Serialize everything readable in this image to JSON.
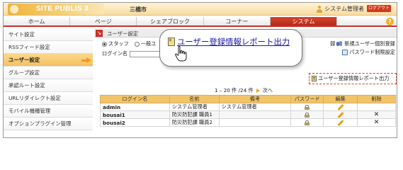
{
  "header": {
    "logo_text": "SITE PUBLIS 3",
    "site_name": "三橋市",
    "user_label": "システム管理者",
    "logout_label": "ログアウト"
  },
  "nav": {
    "tabs": [
      "ホーム",
      "ページ",
      "シェアブロック",
      "コーナー",
      "システム"
    ],
    "active": "システム",
    "help_icon": "?"
  },
  "sidebar": {
    "items": [
      {
        "label": "サイト設定",
        "active": false
      },
      {
        "label": "RSSフィード設定",
        "active": false
      },
      {
        "label": "ユーザー設定",
        "active": true
      },
      {
        "label": "グループ設定",
        "active": false
      },
      {
        "label": "承認ルート設定",
        "active": false
      },
      {
        "label": "URLリダイレクト設定",
        "active": false
      },
      {
        "label": "モバイル機種管理",
        "active": false
      },
      {
        "label": "オプションプラグイン管理",
        "active": false
      }
    ]
  },
  "content": {
    "section_title": "ユーザー設定",
    "radios": [
      {
        "label": "スタッフ",
        "checked": true
      },
      {
        "label": "一般ユ",
        "checked": false
      }
    ],
    "login_label": "ログイン名",
    "right_links": {
      "top_partial": "録",
      "new_individual": "新規ユーザー個別登録",
      "password_settings": "パスワード制限設定"
    },
    "report_link": "ユーザー登録情報レポート出力",
    "pager": {
      "text": "1 – 20 件 /24 件",
      "next": "次へ"
    },
    "table": {
      "columns": [
        "ログイン名",
        "名前",
        "備考",
        "パスワード",
        "編集",
        "削除"
      ],
      "rows": [
        {
          "login": "admin",
          "name": "システム管理者",
          "note": "システム管理者",
          "deletable": false
        },
        {
          "login": "bousai1",
          "name": "防災防犯課 職員1",
          "note": "",
          "deletable": true
        },
        {
          "login": "bousai2",
          "name": "防災防犯課 職員2",
          "note": "",
          "deletable": true
        }
      ]
    }
  },
  "callout": {
    "link_text": "ユーザー登録情報レポート出力"
  },
  "colors": {
    "accent_red": "#c9302a",
    "accent_orange": "#f2c46a",
    "link_blue": "#1a1aa6"
  }
}
